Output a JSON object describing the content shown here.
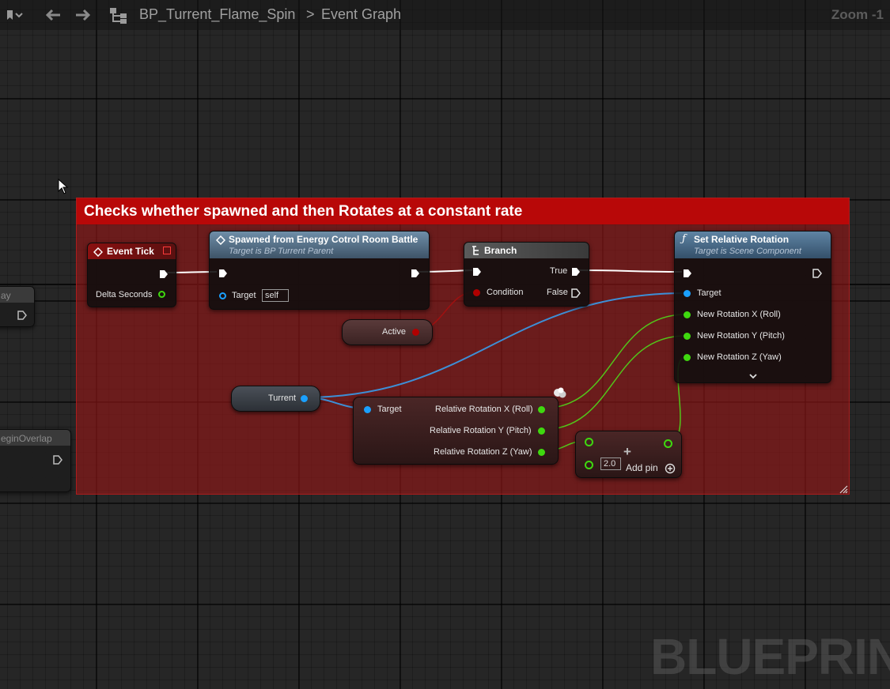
{
  "toolbar": {
    "breadcrumb_asset": "BP_Turrent_Flame_Spin",
    "breadcrumb_separator": ">",
    "breadcrumb_graph": "Event Graph",
    "zoom": "Zoom -1"
  },
  "comment": {
    "title": "Checks whether spawned and then Rotates at a constant rate"
  },
  "nodes": {
    "event_tick": {
      "title": "Event Tick",
      "delta_label": "Delta Seconds"
    },
    "spawned": {
      "title": "Spawned from Energy Cotrol Room Battle",
      "subtitle": "Target is BP Turrent Parent",
      "target_label": "Target",
      "target_value": "self"
    },
    "branch": {
      "title": "Branch",
      "condition_label": "Condition",
      "true_label": "True",
      "false_label": "False"
    },
    "active_var": {
      "label": "Active"
    },
    "set_rotation": {
      "title": "Set Relative Rotation",
      "subtitle": "Target is Scene Component",
      "pins": [
        "Target",
        "New Rotation X (Roll)",
        "New Rotation Y (Pitch)",
        "New Rotation Z (Yaw)"
      ]
    },
    "turrent_var": {
      "label": "Turrent"
    },
    "break_rotation": {
      "target_label": "Target",
      "outputs": [
        "Relative Rotation X (Roll)",
        "Relative Rotation Y (Pitch)",
        "Relative Rotation Z (Yaw)"
      ]
    },
    "multiply": {
      "symbol": "+",
      "value": "2.0",
      "add_pin_label": "Add pin"
    },
    "left_node_a": {
      "title_fragment": "ay"
    },
    "left_node_b": {
      "title_fragment": "eginOverlap"
    }
  },
  "watermark": "BLUEPRINT",
  "colors": {
    "comment_bar": "#b80808",
    "exec_wire": "#ffffff",
    "object_pin": "#1aa0ff",
    "float_pin": "#3fd80f",
    "bool_pin": "#b00000"
  }
}
